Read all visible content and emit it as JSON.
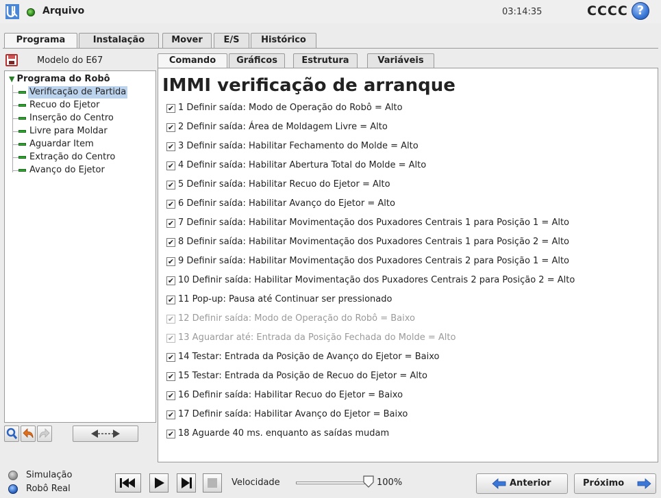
{
  "header": {
    "file_label": "Arquivo",
    "clock": "03:14:35",
    "robot_name": "CCCC",
    "help_glyph": "?"
  },
  "main_tabs": [
    {
      "label": "Programa",
      "active": true
    },
    {
      "label": "Instalação",
      "active": false
    },
    {
      "label": "Mover",
      "active": false
    },
    {
      "label": "E/S",
      "active": false
    },
    {
      "label": "Histórico",
      "active": false
    }
  ],
  "left_panel": {
    "model_name": "Modelo do E67",
    "tree_root": "Programa do Robô",
    "tree_items": [
      {
        "label": "Verificação de Partida",
        "selected": true
      },
      {
        "label": "Recuo do Ejetor",
        "selected": false
      },
      {
        "label": "Inserção do Centro",
        "selected": false
      },
      {
        "label": "Livre para Moldar",
        "selected": false
      },
      {
        "label": "Aguardar Item",
        "selected": false
      },
      {
        "label": "Extração do Centro",
        "selected": false
      },
      {
        "label": "Avanço do Ejetor",
        "selected": false
      }
    ]
  },
  "sub_tabs": [
    {
      "label": "Comando",
      "active": true
    },
    {
      "label": "Gráficos",
      "active": false
    },
    {
      "label": "Estrutura",
      "active": false
    },
    {
      "label": "Variáveis",
      "active": false
    }
  ],
  "content": {
    "title": "IMMI verificação de arranque",
    "checkbox_glyph": "✔",
    "commands": [
      {
        "text": "1 Definir saída: Modo de Operação do Robô = Alto",
        "checked": true,
        "enabled": true
      },
      {
        "text": "2 Definir saída: Área de Moldagem Livre = Alto",
        "checked": true,
        "enabled": true
      },
      {
        "text": "3 Definir saída: Habilitar Fechamento do Molde = Alto",
        "checked": true,
        "enabled": true
      },
      {
        "text": "4 Definir saída: Habilitar Abertura Total do Molde = Alto",
        "checked": true,
        "enabled": true
      },
      {
        "text": "5 Definir saída: Habilitar Recuo do Ejetor = Alto",
        "checked": true,
        "enabled": true
      },
      {
        "text": "6 Definir saída: Habilitar Avanço do Ejetor = Alto",
        "checked": true,
        "enabled": true
      },
      {
        "text": "7 Definir saída: Habilitar Movimentação dos Puxadores Centrais 1 para Posição 1 = Alto",
        "checked": true,
        "enabled": true
      },
      {
        "text": "8 Definir saída: Habilitar Movimentação dos Puxadores Centrais 1 para Posição 2 = Alto",
        "checked": true,
        "enabled": true
      },
      {
        "text": "9 Definir saída: Habilitar Movimentação dos Puxadores Centrais 2 para Posição 1 = Alto",
        "checked": true,
        "enabled": true
      },
      {
        "text": "10 Definir saída: Habilitar Movimentação dos Puxadores Centrais 2 para Posição 2 = Alto",
        "checked": true,
        "enabled": true
      },
      {
        "text": "11 Pop-up: Pausa até Continuar ser pressionado",
        "checked": true,
        "enabled": true
      },
      {
        "text": "12 Definir saída: Modo de Operação do Robô = Baixo",
        "checked": true,
        "enabled": false
      },
      {
        "text": "13 Aguardar até: Entrada da Posição Fechada do Molde = Alto",
        "checked": true,
        "enabled": false
      },
      {
        "text": "14 Testar: Entrada da Posição de Avanço do Ejetor = Baixo",
        "checked": true,
        "enabled": true
      },
      {
        "text": "15 Testar: Entrada da Posição de Recuo do Ejetor = Alto",
        "checked": true,
        "enabled": true
      },
      {
        "text": "16 Definir saída: Habilitar Recuo do Ejetor = Baixo",
        "checked": true,
        "enabled": true
      },
      {
        "text": "17 Definir saída: Habilitar Avanço do Ejetor = Baixo",
        "checked": true,
        "enabled": true
      },
      {
        "text": "18 Aguarde 40 ms. enquanto as saídas mudam",
        "checked": true,
        "enabled": true
      }
    ]
  },
  "footer": {
    "mode_simulation": "Simulação",
    "mode_real": "Robô Real",
    "speed_label": "Velocidade",
    "speed_value": "100%",
    "speed_fraction": 1.0,
    "prev_label": "Anterior",
    "next_label": "Próximo"
  },
  "colors": {
    "accent_blue": "#3a77d6",
    "selected_row": "#bcd3ee",
    "node_green": "#2ea52e",
    "disabled_text": "#9a9a9a"
  }
}
